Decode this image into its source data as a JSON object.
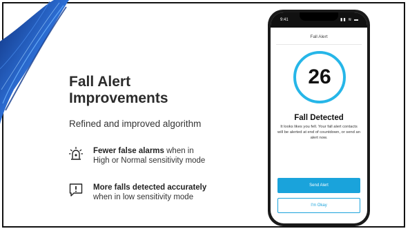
{
  "slide": {
    "title": "Fall Alert Improvements",
    "subtitle": "Refined and improved algorithm",
    "features": [
      {
        "icon": "siren-icon",
        "bold": "Fewer false alarms",
        "rest_line1": " when in",
        "line2": "High or Normal sensitivity mode"
      },
      {
        "icon": "alert-message-icon",
        "bold": "More falls detected accurately",
        "line2": "when in low sensitivity mode"
      }
    ]
  },
  "phone": {
    "status_time": "9:41",
    "status_icons": "▮▮ ≋ ▬",
    "app_title": "Fall Alert",
    "countdown": "26",
    "detect_title": "Fall Detected",
    "detect_body": "It looks likes you fell. Your fall alert contacts will be alerted at end of countdown, or send an alert now.",
    "primary_button": "Send Alert",
    "secondary_button": "I'm Okay"
  },
  "colors": {
    "accent": "#26b6e8",
    "button": "#1aa3db",
    "swirl": "#1d4ea8"
  }
}
